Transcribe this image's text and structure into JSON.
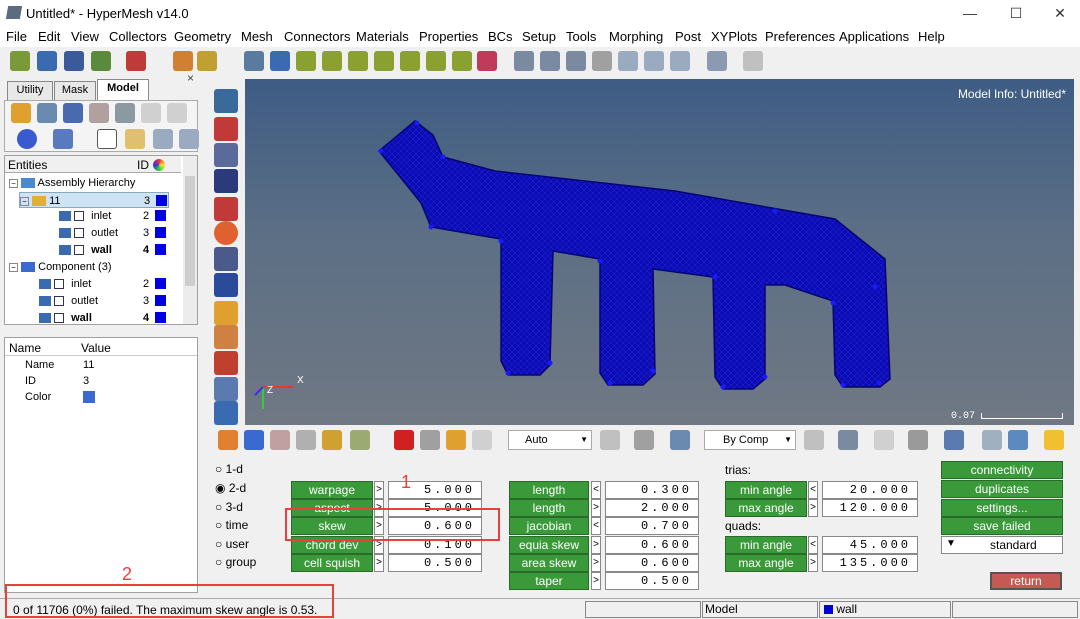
{
  "window": {
    "title": "Untitled* - HyperMesh v14.0",
    "minimize": "—",
    "maximize": "☐",
    "close": "✕"
  },
  "menu": [
    "File",
    "Edit",
    "View",
    "Collectors",
    "Geometry",
    "Mesh",
    "Connectors",
    "Materials",
    "Properties",
    "BCs",
    "Setup",
    "Tools",
    "Morphing",
    "Post",
    "XYPlots",
    "Preferences",
    "Applications",
    "Help"
  ],
  "browser": {
    "tabs": [
      "Utility",
      "Mask",
      "Model"
    ],
    "entities_header": "Entities",
    "id_header": "ID",
    "tree": [
      {
        "label": "Assembly Hierarchy",
        "id": ""
      },
      {
        "label": "11",
        "id": "3"
      },
      {
        "label": "inlet",
        "id": "2"
      },
      {
        "label": "outlet",
        "id": "3"
      },
      {
        "label": "wall",
        "id": "4"
      },
      {
        "label": "Component (3)",
        "id": ""
      },
      {
        "label": "inlet",
        "id": "2"
      },
      {
        "label": "outlet",
        "id": "3"
      },
      {
        "label": "wall",
        "id": "4"
      }
    ],
    "props_header": {
      "name": "Name",
      "value": "Value"
    },
    "props": [
      {
        "name": "Name",
        "value": "11"
      },
      {
        "name": "ID",
        "value": "3"
      },
      {
        "name": "Color",
        "value": ""
      }
    ]
  },
  "viewport": {
    "model_info": "Model Info: Untitled*",
    "scale": "0.07",
    "axis_z": "Z",
    "axis_x": "X"
  },
  "toolbar2": {
    "auto_label": "Auto",
    "bycomp_label": "By Comp"
  },
  "panel": {
    "radios": [
      {
        "label": "1-d",
        "checked": false
      },
      {
        "label": "2-d",
        "checked": true
      },
      {
        "label": "3-d",
        "checked": false
      },
      {
        "label": "time",
        "checked": false
      },
      {
        "label": "user",
        "checked": false
      },
      {
        "label": "group",
        "checked": false
      }
    ],
    "col1": [
      {
        "label": "warpage",
        "op": ">",
        "value": "5.000"
      },
      {
        "label": "aspect",
        "op": ">",
        "value": "5.000"
      },
      {
        "label": "skew",
        "op": ">",
        "value": "0.600"
      },
      {
        "label": "chord dev",
        "op": ">",
        "value": "0.100"
      },
      {
        "label": "cell squish",
        "op": ">",
        "value": "0.500"
      }
    ],
    "col2": [
      {
        "label": "length",
        "op": "<",
        "value": "0.300"
      },
      {
        "label": "length",
        "op": ">",
        "value": "2.000"
      },
      {
        "label": "jacobian",
        "op": "<",
        "value": "0.700"
      },
      {
        "label": "equia skew",
        "op": ">",
        "value": "0.600"
      },
      {
        "label": "area skew",
        "op": ">",
        "value": "0.600"
      },
      {
        "label": "taper",
        "op": ">",
        "value": "0.500"
      }
    ],
    "trias_label": "trias:",
    "quads_label": "quads:",
    "trias": [
      {
        "label": "min angle",
        "op": "<",
        "value": "20.000"
      },
      {
        "label": "max angle",
        "op": ">",
        "value": "120.000"
      }
    ],
    "quads": [
      {
        "label": "min angle",
        "op": "<",
        "value": "45.000"
      },
      {
        "label": "max angle",
        "op": ">",
        "value": "135.000"
      }
    ],
    "right_buttons": [
      "connectivity",
      "duplicates",
      "settings...",
      "save failed"
    ],
    "standard": "standard",
    "return": "return"
  },
  "annotations": {
    "n1": "1",
    "n2": "2"
  },
  "status": {
    "message": "0 of 11706 (0%) failed.  The maximum skew angle is 0.53.",
    "model": "Model",
    "comp": "wall"
  }
}
